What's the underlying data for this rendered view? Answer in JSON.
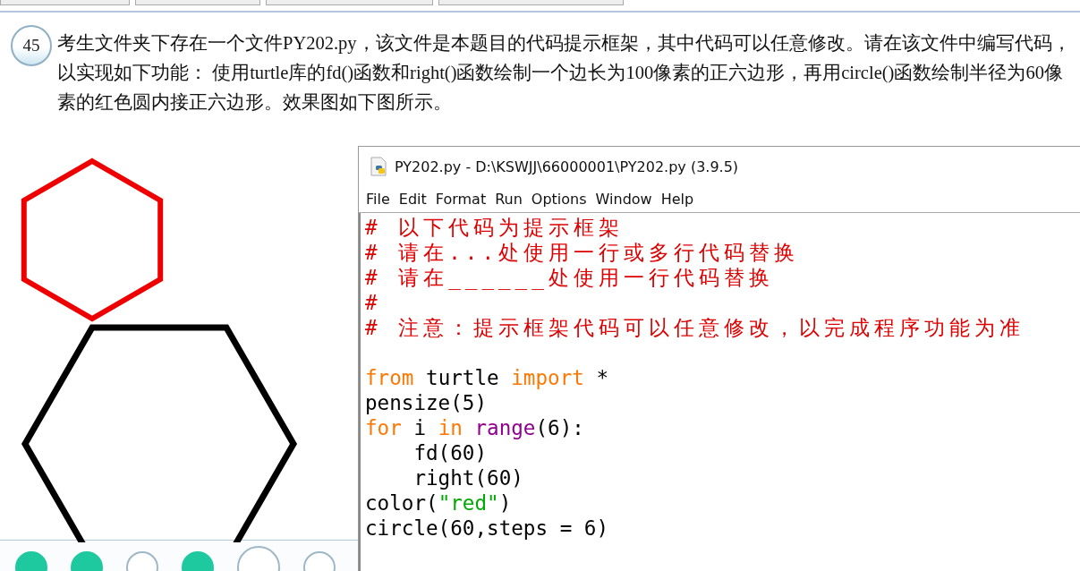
{
  "question": {
    "number": "45",
    "text": "考生文件夹下存在一个文件PY202.py，该文件是本题目的代码提示框架，其中代码可以任意修改。请在该文件中编写代码，以实现如下功能： 使用turtle库的fd()函数和right()函数绘制一个边长为100像素的正六边形，再用circle()函数绘制半径为60像素的红色圆内接正六边形。效果图如下图所示。"
  },
  "navigator": [
    {
      "answered": true,
      "selected": false
    },
    {
      "answered": true,
      "selected": false
    },
    {
      "answered": false,
      "selected": false
    },
    {
      "answered": true,
      "selected": false
    },
    {
      "answered": false,
      "selected": true
    },
    {
      "answered": false,
      "selected": false
    }
  ],
  "editor": {
    "title": "PY202.py - D:\\KSWJJ\\66000001\\PY202.py (3.9.5)",
    "menu": [
      "File",
      "Edit",
      "Format",
      "Run",
      "Options",
      "Window",
      "Help"
    ],
    "lines": [
      [
        {
          "text": "# 以下代码为提示框架",
          "kind": "comment"
        }
      ],
      [
        {
          "text": "# 请在...处使用一行或多行代码替换",
          "kind": "comment"
        }
      ],
      [
        {
          "text": "# 请在______处使用一行代码替换",
          "kind": "comment"
        }
      ],
      [
        {
          "text": "#",
          "kind": "comment"
        }
      ],
      [
        {
          "text": "# 注意：提示框架代码可以任意修改，以完成程序功能为准",
          "kind": "comment"
        }
      ],
      [
        {
          "text": "from",
          "kind": "keyword",
          "gap_before": true
        },
        {
          "text": " turtle ",
          "kind": "plain"
        },
        {
          "text": "import",
          "kind": "keyword"
        },
        {
          "text": " *",
          "kind": "plain"
        }
      ],
      [
        {
          "text": "pensize(5)",
          "kind": "plain"
        }
      ],
      [
        {
          "text": "for",
          "kind": "keyword"
        },
        {
          "text": " i ",
          "kind": "plain"
        },
        {
          "text": "in",
          "kind": "keyword"
        },
        {
          "text": " range",
          "kind": "builtin"
        },
        {
          "text": "(6):",
          "kind": "plain"
        }
      ],
      [
        {
          "text": "    fd(60)",
          "kind": "plain"
        }
      ],
      [
        {
          "text": "    right(60)",
          "kind": "plain"
        }
      ],
      [
        {
          "text": "color(",
          "kind": "plain"
        },
        {
          "text": "\"red\"",
          "kind": "string"
        },
        {
          "text": ")",
          "kind": "plain"
        }
      ],
      [
        {
          "text": "circle(60,steps = 6)",
          "kind": "plain"
        }
      ]
    ]
  }
}
